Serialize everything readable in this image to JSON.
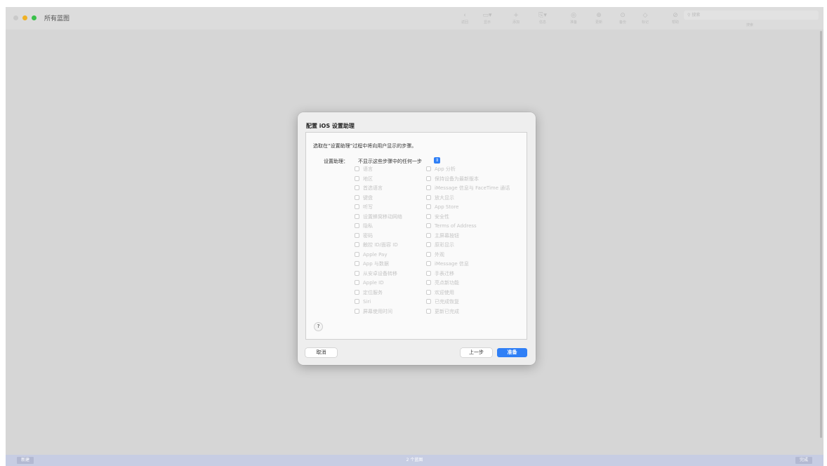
{
  "window": {
    "title": "所有蓝图",
    "toolbar": [
      {
        "icon": "chevron-left-icon",
        "glyph": "‹",
        "label": "返回"
      },
      {
        "icon": "display-icon",
        "glyph": "▭▾",
        "label": "显示"
      },
      {
        "icon": "add-icon",
        "glyph": "+",
        "label": "添加"
      },
      {
        "icon": "apps-icon",
        "glyph": "⎘▾",
        "label": "信息"
      },
      {
        "icon": "prepare-icon",
        "glyph": "◎",
        "label": "准备"
      },
      {
        "icon": "update-icon",
        "glyph": "⊕",
        "label": "更新"
      },
      {
        "icon": "backup-icon",
        "glyph": "⊙",
        "label": "备份"
      },
      {
        "icon": "tag-icon",
        "glyph": "◇",
        "label": "标记"
      },
      {
        "icon": "help-icon",
        "glyph": "⊘",
        "label": "帮助"
      }
    ],
    "search": {
      "placeholder": "搜索",
      "label": "搜索"
    }
  },
  "bottom_bar": {
    "new_label": "新建",
    "status": "2 个蓝图",
    "done_label": "完成"
  },
  "dialog": {
    "title": "配置 iOS 设置助理",
    "instruction": "选取在“设置助理”过程中将向用户显示的步骤。",
    "assistant_label": "设置助理：",
    "assistant_value": "不显示这些步骤中的任何一步",
    "options_left": [
      "语言",
      "地区",
      "首选语言",
      "键盘",
      "听写",
      "设置蜂窝移动网络",
      "隐私",
      "密码",
      "触控 ID/面容 ID",
      "Apple Pay",
      "App 与数据",
      "从安卓设备转移",
      "Apple ID",
      "定位服务",
      "Siri",
      "屏幕使用时间"
    ],
    "options_right": [
      "App 分析",
      "保持设备为最新版本",
      "iMessage 信息与 FaceTime 通话",
      "放大显示",
      "App Store",
      "安全性",
      "Terms of Address",
      "主屏幕按钮",
      "原彩显示",
      "外观",
      "iMessage 信息",
      "手表迁移",
      "亮点新功能",
      "欢迎使用",
      "已完成恢复",
      "更新已完成"
    ],
    "help_label": "?",
    "cancel_label": "取消",
    "back_label": "上一步",
    "ready_label": "准备"
  }
}
